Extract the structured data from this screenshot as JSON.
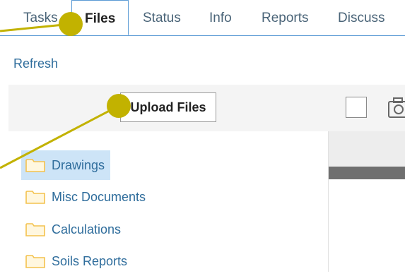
{
  "tabs": [
    {
      "label": "Tasks"
    },
    {
      "label": "Files"
    },
    {
      "label": "Status"
    },
    {
      "label": "Info"
    },
    {
      "label": "Reports"
    },
    {
      "label": "Discuss"
    }
  ],
  "active_tab": "Files",
  "refresh_label": "Refresh",
  "toolbar": {
    "upload_label": "Upload Files",
    "select_all_checked": false,
    "camera_icon": "camera-icon"
  },
  "folders": [
    {
      "label": "Drawings",
      "selected": true,
      "icon": "folder-icon"
    },
    {
      "label": "Misc Documents",
      "selected": false,
      "icon": "folder-icon"
    },
    {
      "label": "Calculations",
      "selected": false,
      "icon": "folder-icon"
    },
    {
      "label": "Soils Reports",
      "selected": false,
      "icon": "folder-icon"
    }
  ],
  "colors": {
    "accent": "#5b9bd5",
    "link": "#2f6d9c",
    "selected_bg": "#cde4f7",
    "annotation": "#c2b200",
    "folder": "#f3c24e"
  }
}
